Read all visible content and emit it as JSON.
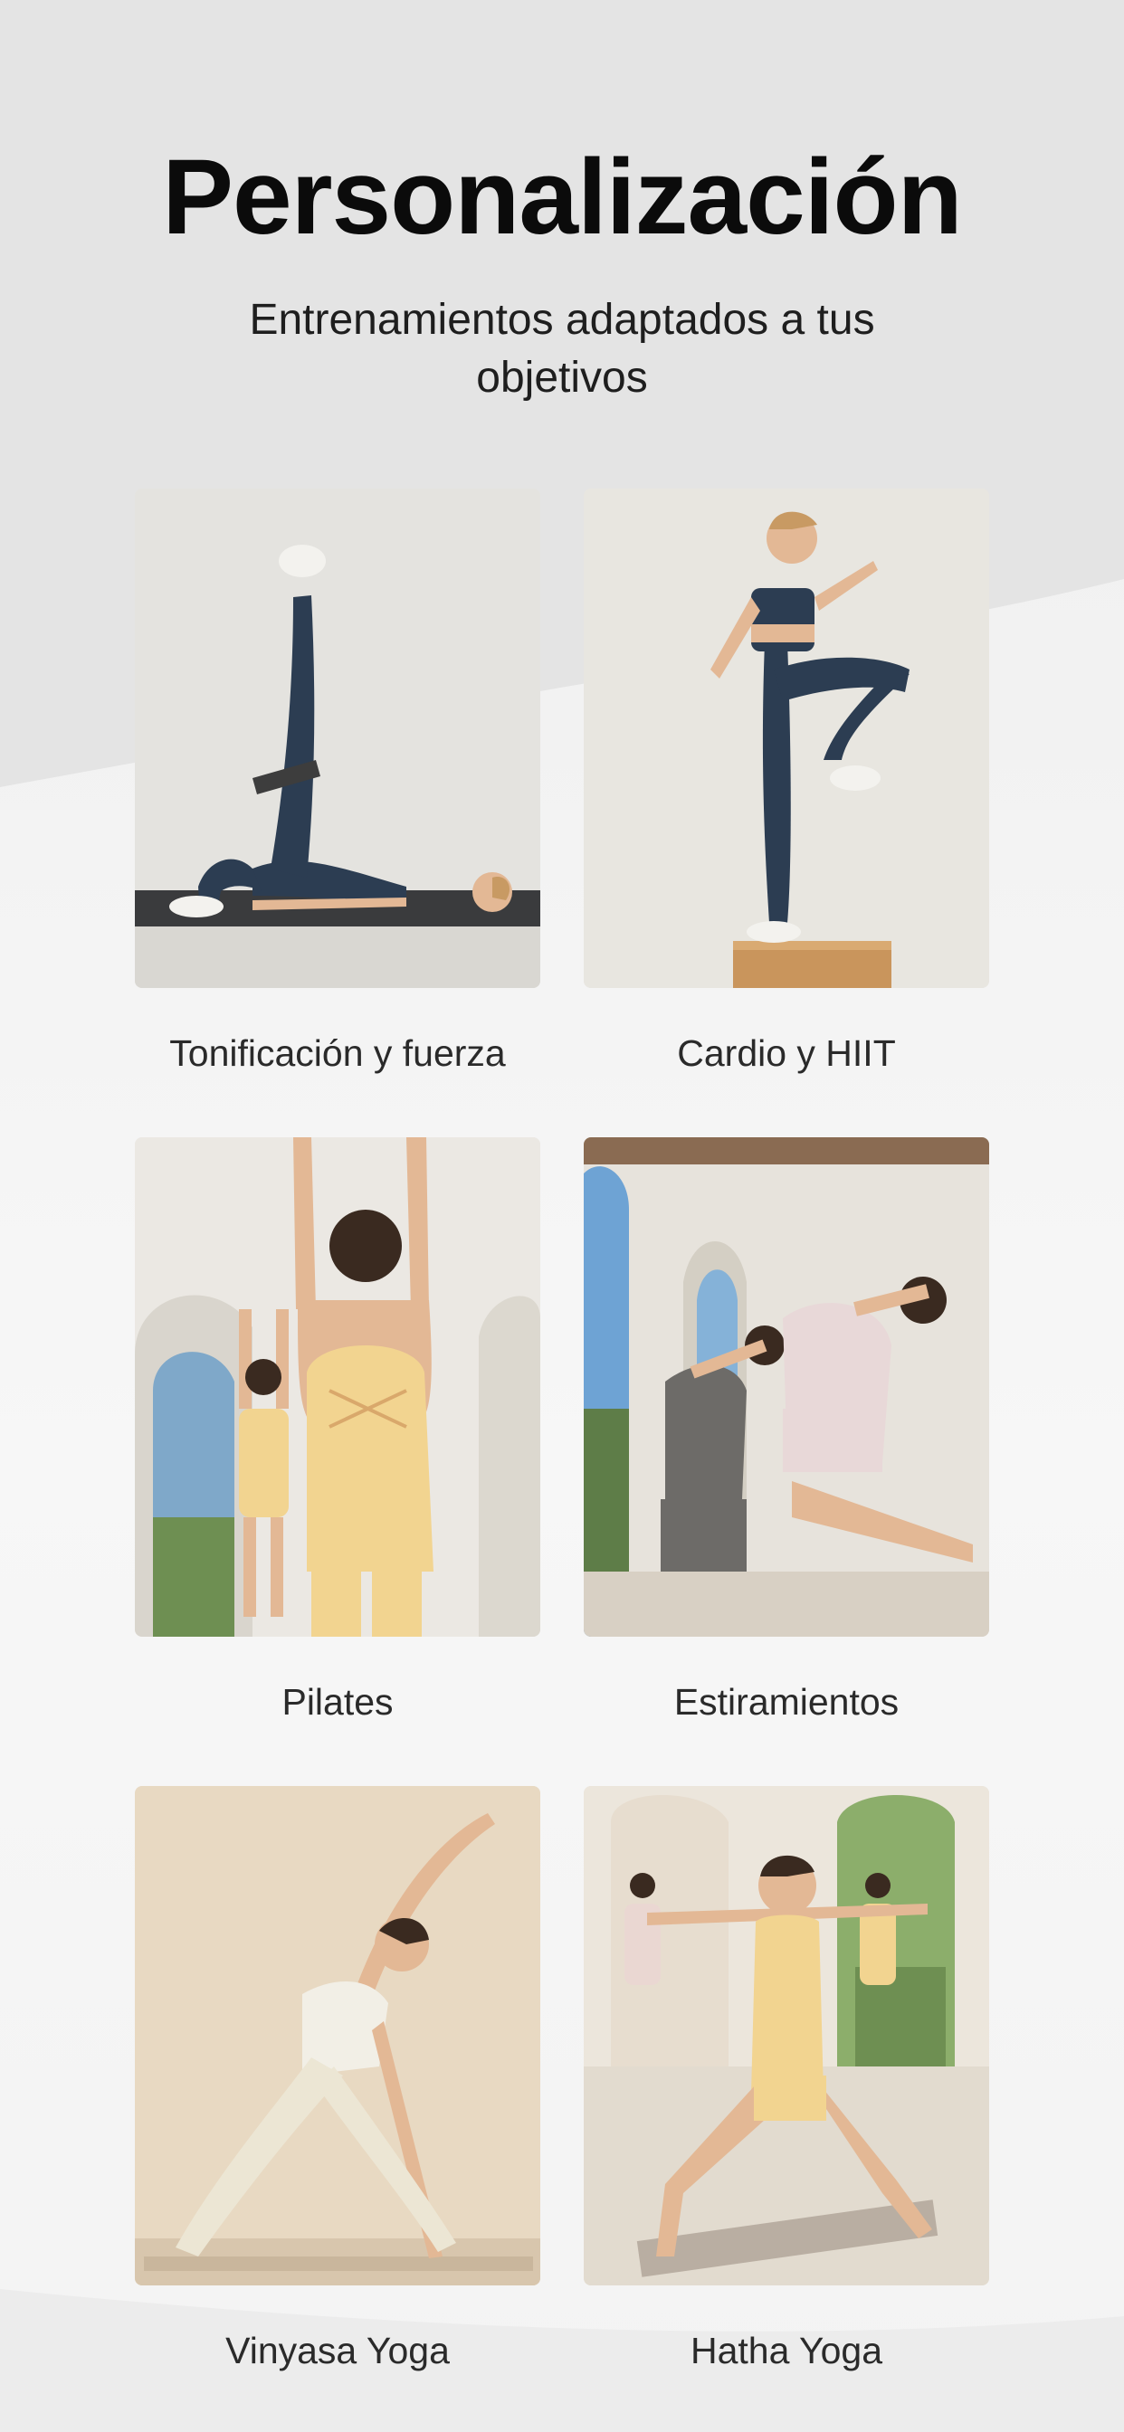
{
  "header": {
    "title": "Personalización",
    "subtitle": "Entrenamientos adaptados a tus objetivos"
  },
  "workouts": [
    {
      "label": "Tonificación y fuerza",
      "image": "glute-bridge-with-band-photo"
    },
    {
      "label": "Cardio y HIIT",
      "image": "step-up-knee-drive-photo"
    },
    {
      "label": "Pilates",
      "image": "arms-overhead-stretch-photo"
    },
    {
      "label": "Estiramientos",
      "image": "camel-pose-backbend-photo"
    },
    {
      "label": "Vinyasa Yoga",
      "image": "extended-side-angle-pose-photo"
    },
    {
      "label": "Hatha Yoga",
      "image": "warrior-two-pose-photo"
    }
  ],
  "colors": {
    "title": "#0b0b0b",
    "label": "#2a2a2a",
    "navy_outfit": "#2c3d52",
    "butter_outfit": "#f2d490",
    "background": "#f3f3f3"
  }
}
